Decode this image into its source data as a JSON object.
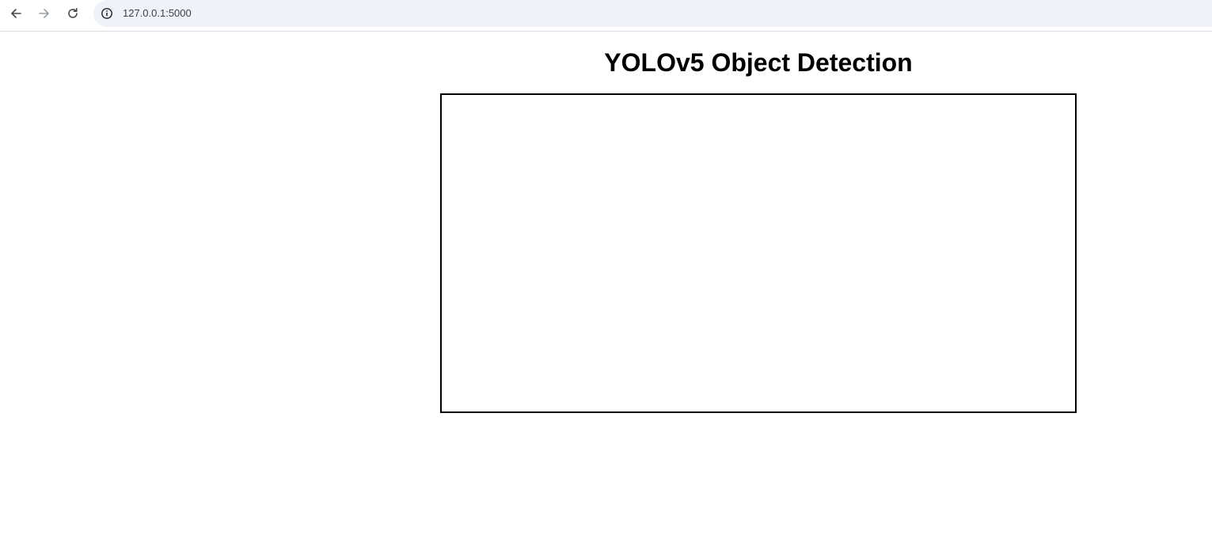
{
  "browser": {
    "url": "127.0.0.1:5000",
    "icons": {
      "back": "arrow-left-icon",
      "forward": "arrow-right-icon",
      "reload": "reload-icon",
      "site_info": "info-icon"
    },
    "colors": {
      "omnibox_bg": "#eef2f9",
      "icon_active": "#474747",
      "icon_disabled": "#9aa0a6"
    }
  },
  "page": {
    "title": "YOLOv5 Object Detection",
    "video_feed": {
      "border_color": "#000000"
    }
  }
}
